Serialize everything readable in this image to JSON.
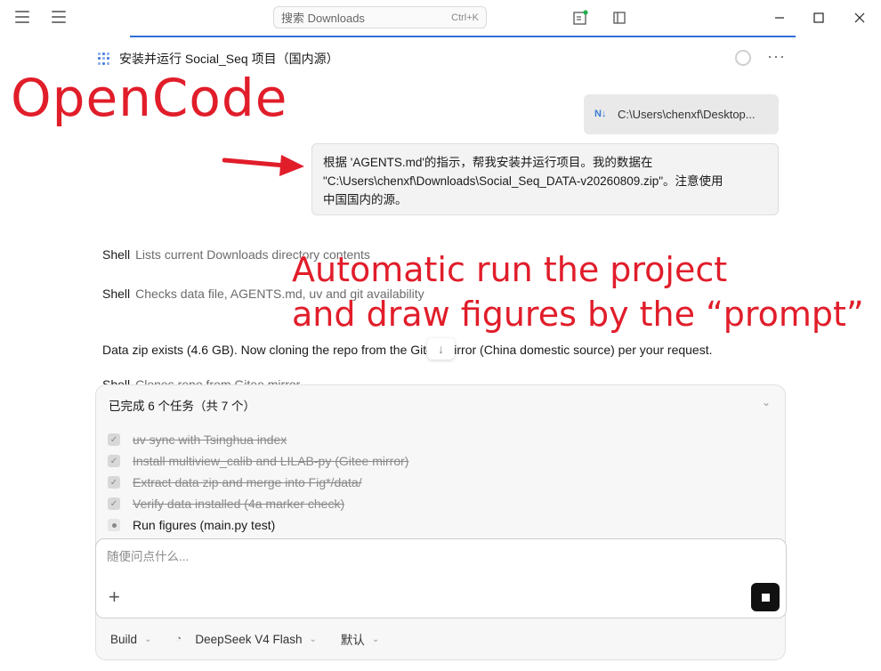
{
  "titlebar": {
    "search_placeholder": "搜索 Downloads",
    "search_shortcut": "Ctrl+K"
  },
  "session": {
    "title": "安装并运行 Social_Seq 项目（国内源）"
  },
  "overlay": {
    "brand": "OpenCode",
    "annotation_line1": "Automatic run the project",
    "annotation_line2": "and draw figures by the “prompt”"
  },
  "attachment": {
    "label": "C:\\Users\\chenxf\\Desktop..."
  },
  "user_message": {
    "line1": "根据 'AGENTS.md'的指示，帮我安装并运行项目。我的数据在",
    "line2": "\"C:\\Users\\chenxf\\Downloads\\Social_Seq_DATA-v20260809.zip\"。注意使用",
    "line3": "中国国内的源。"
  },
  "transcript": [
    {
      "tool": "Shell",
      "desc": "Lists current Downloads directory contents"
    },
    {
      "tool": "Shell",
      "desc": "Checks data file, AGENTS.md, uv and git availability"
    },
    {
      "text": "Data zip exists (4.6 GB). Now cloning the repo from the Gitee mirror (China domestic source) per your request."
    },
    {
      "tool": "Shell",
      "desc": "Clones repo from Gitee mirror"
    }
  ],
  "tasks": {
    "summary": "已完成 6 个任务（共 7 个）",
    "items": [
      {
        "label": "uv sync with Tsinghua index",
        "status": "done"
      },
      {
        "label": "Install multiview_calib and LILAB-py (Gitee mirror)",
        "status": "done"
      },
      {
        "label": "Extract data zip and merge into Fig*/data/",
        "status": "done"
      },
      {
        "label": "Verify data installed (4a marker check)",
        "status": "done"
      },
      {
        "label": "Run figures (main.py test)",
        "status": "in_progress"
      }
    ]
  },
  "composer": {
    "placeholder": "随便问点什么..."
  },
  "footer": {
    "agent": "Build",
    "model": "DeepSeek V4 Flash",
    "variant": "默认"
  },
  "colors": {
    "accent": "#2f6fd6",
    "annotation_red": "#e11d2a"
  }
}
